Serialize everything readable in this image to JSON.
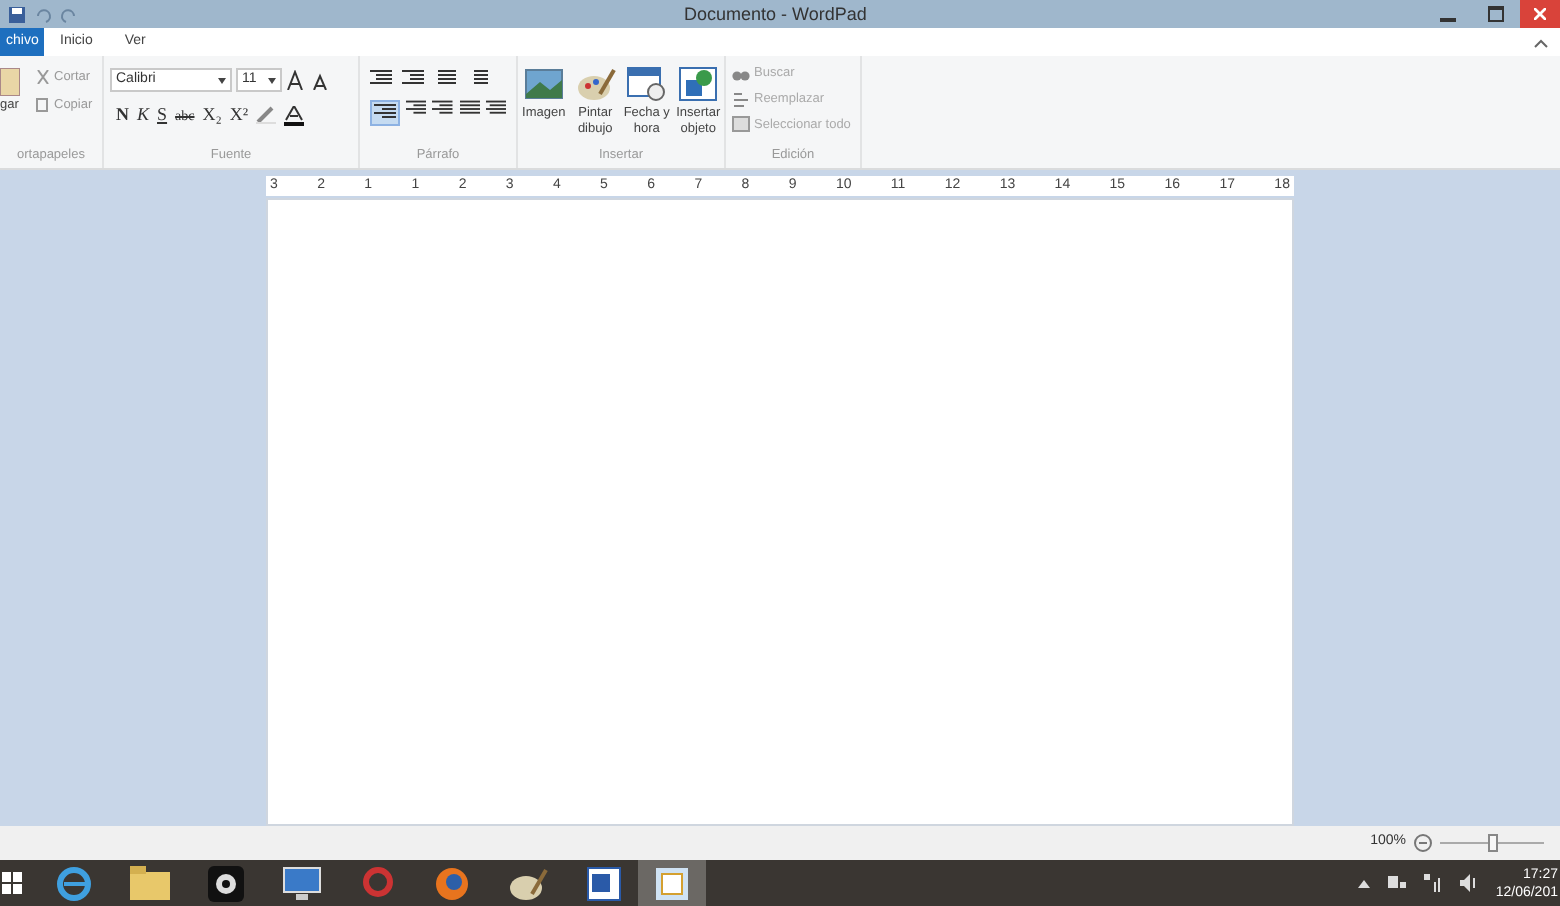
{
  "window": {
    "title": "Documento - WordPad"
  },
  "tabs": [
    {
      "label": "chivo",
      "selected": true
    },
    {
      "label": "Inicio",
      "selected": false
    },
    {
      "label": "Ver",
      "selected": false
    }
  ],
  "ribbon": {
    "clipboard": {
      "paste": "gar",
      "cut": "Cortar",
      "copy": "Copiar",
      "group": "ortapapeles"
    },
    "font": {
      "family": "Calibri",
      "size": "11",
      "format": [
        {
          "label": "N",
          "kind": "bold"
        },
        {
          "label": "K",
          "kind": "italic"
        },
        {
          "label": "S",
          "kind": "underline"
        },
        {
          "label": "abc",
          "kind": "strike"
        },
        {
          "label": "X₂",
          "kind": "plain"
        },
        {
          "label": "X²",
          "kind": "plain"
        }
      ],
      "group": "Fuente"
    },
    "paragraph": {
      "group": "Párrafo"
    },
    "insert": {
      "items": [
        {
          "label": "Imagen",
          "kind": "image"
        },
        {
          "label": "Pintar dibujo",
          "kind": "paint"
        },
        {
          "label": "Fecha y hora",
          "kind": "calendar"
        },
        {
          "label": "Insertar objeto",
          "kind": "object"
        }
      ],
      "group": "Insertar"
    },
    "editing": {
      "items": [
        {
          "label": "Buscar",
          "kind": "find"
        },
        {
          "label": "Reemplazar",
          "kind": "replace"
        },
        {
          "label": "Seleccionar todo",
          "kind": "select"
        }
      ],
      "group": "Edición"
    }
  },
  "ruler": [
    "3",
    "2",
    "1",
    "1",
    "2",
    "3",
    "4",
    "5",
    "6",
    "7",
    "8",
    "9",
    "10",
    "11",
    "12",
    "13",
    "14",
    "15",
    "16",
    "17",
    "18"
  ],
  "status_bar": {
    "zoom": "100%",
    "zoom_slider": {
      "level": 0.5
    }
  },
  "taskbar": {
    "time": "17:27",
    "date": "12/06/201"
  }
}
